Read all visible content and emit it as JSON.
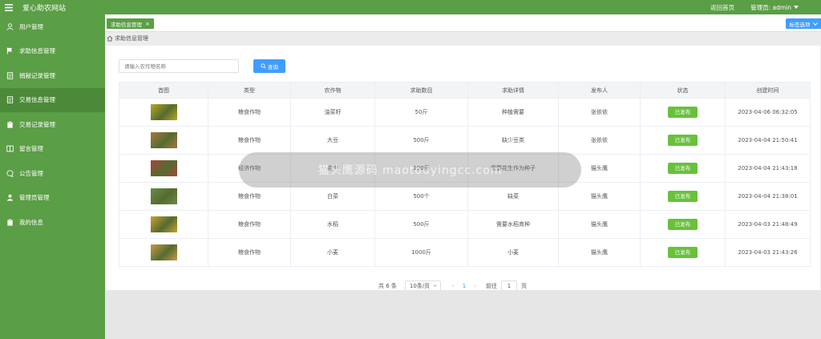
{
  "app": {
    "title": "爱心助农网站",
    "back_home": "返回首页",
    "admin_label": "管理员: admin"
  },
  "colors": {
    "sidebar": "#5a9e45",
    "active_item": "#4c8a3a",
    "primary": "#409eff",
    "status": "#67c23a"
  },
  "sidebar": {
    "items": [
      {
        "label": "用户管理",
        "icon": "user-icon"
      },
      {
        "label": "求助信息管理",
        "icon": "flag-icon"
      },
      {
        "label": "捐献记录管理",
        "icon": "document-icon"
      },
      {
        "label": "交易信息管理",
        "icon": "document-icon",
        "active": true
      },
      {
        "label": "交易记录管理",
        "icon": "clipboard-icon"
      },
      {
        "label": "留言管理",
        "icon": "book-icon"
      },
      {
        "label": "公告管理",
        "icon": "chat-icon"
      },
      {
        "label": "管理员管理",
        "icon": "user-icon"
      },
      {
        "label": "我的信息",
        "icon": "clipboard-icon"
      }
    ]
  },
  "tabs": {
    "active": "求助信息管理",
    "options": "标签选项"
  },
  "breadcrumb": "求助信息管理",
  "search": {
    "placeholder": "请输入农作物名称",
    "button": "查询"
  },
  "table": {
    "headers": [
      "首图",
      "类型",
      "农作物",
      "求助数目",
      "求助详情",
      "发布人",
      "状态",
      "创建时间"
    ],
    "rows": [
      {
        "type": "粮食作物",
        "crop": "油菜籽",
        "amount": "50斤",
        "detail": "种植需要",
        "publisher": "张依依",
        "status": "已发布",
        "created": "2023-04-06 06:32:05",
        "thumb": "#b8a822"
      },
      {
        "type": "粮食作物",
        "crop": "大豆",
        "amount": "500斤",
        "detail": "缺少豆类",
        "publisher": "张依依",
        "status": "已发布",
        "created": "2023-04-04 21:50:41",
        "thumb": "#a8763e"
      },
      {
        "type": "经济作物",
        "crop": "花生",
        "amount": "100斤",
        "detail": "需要花生作为种子",
        "publisher": "猫头鹰",
        "status": "已发布",
        "created": "2023-04-04 21:43:18",
        "thumb": "#a4453a"
      },
      {
        "type": "粮食作物",
        "crop": "白菜",
        "amount": "500个",
        "detail": "缺菜",
        "publisher": "猫头鹰",
        "status": "已发布",
        "created": "2023-04-04 21:38:01",
        "thumb": "#6a8a4a"
      },
      {
        "type": "粮食作物",
        "crop": "水稻",
        "amount": "500斤",
        "detail": "需要水稻育种",
        "publisher": "猫头鹰",
        "status": "已发布",
        "created": "2023-04-03 21:48:49",
        "thumb": "#c8a030"
      },
      {
        "type": "粮食作物",
        "crop": "小麦",
        "amount": "1000斤",
        "detail": "小麦",
        "publisher": "猫头鹰",
        "status": "已发布",
        "created": "2023-04-03 21:43:26",
        "thumb": "#c89a48"
      }
    ]
  },
  "pagination": {
    "total": "共 6 条",
    "page_size": "10条/页",
    "current": "1",
    "goto": "前往",
    "goto_value": "1",
    "page_unit": "页"
  },
  "overlay": "猫头鹰源码 maotouyingcc.com"
}
